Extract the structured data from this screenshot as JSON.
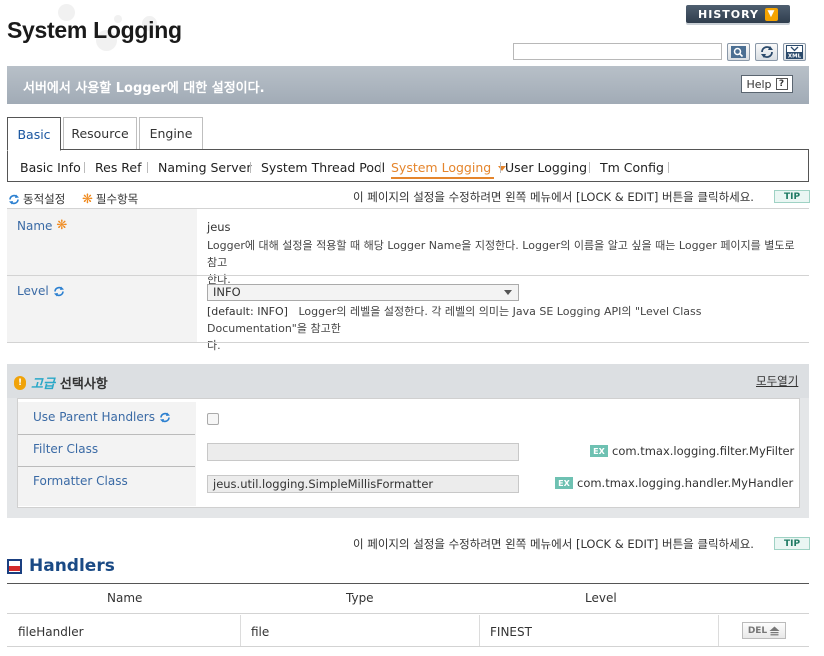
{
  "header": {
    "title": "System Logging",
    "history_label": "HISTORY",
    "search": {
      "value": "",
      "placeholder": ""
    }
  },
  "banner": {
    "text": "서버에서 사용할 Logger에 대한 설정이다.",
    "help_label": "Help",
    "help_icon": "?"
  },
  "tabs": [
    {
      "label": "Basic",
      "active": true
    },
    {
      "label": "Resource",
      "active": false
    },
    {
      "label": "Engine",
      "active": false
    }
  ],
  "subnav": [
    {
      "label": "Basic Info"
    },
    {
      "label": "Res Ref"
    },
    {
      "label": "Naming Server"
    },
    {
      "label": "System Thread Pool"
    },
    {
      "label": "System Logging",
      "active": true
    },
    {
      "label": "User Logging"
    },
    {
      "label": "Tm Config"
    }
  ],
  "legend": {
    "dynamic": "동적설정",
    "required": "필수항목"
  },
  "notice": "이 페이지의 설정을 수정하려면 왼쪽 메뉴에서 [LOCK & EDIT] 버튼을 클릭하세요.",
  "tip_label": "TIP",
  "fields": {
    "name": {
      "label": "Name",
      "value": "jeus",
      "desc_line1": "Logger에 대해 설정을 적용할 때 해당 Logger Name을 지정한다. Logger의 이름을 알고 싶을 때는 Logger 페이지를 별도로 참고",
      "desc_line2": "한다."
    },
    "level": {
      "label": "Level",
      "selected": "INFO",
      "default_text": "[default: INFO]",
      "desc_line1": "Logger의 레벨을 설정한다. 각 레벨의 의미는 Java SE Logging API의 \"Level Class Documentation\"을 참고한",
      "desc_line2": "다."
    }
  },
  "advanced": {
    "title_keyword": "고급",
    "title_rest": "선택사항",
    "open_all": "모두열기",
    "use_parent_handlers": {
      "label": "Use Parent Handlers",
      "checked": false
    },
    "filter_class": {
      "label": "Filter Class",
      "value": "",
      "example": "com.tmax.logging.filter.MyFilter"
    },
    "formatter_class": {
      "label": "Formatter Class",
      "value": "jeus.util.logging.SimpleMillisFormatter",
      "example": "com.tmax.logging.handler.MyHandler"
    },
    "ex_badge": "EX"
  },
  "handlers": {
    "title": "Handlers",
    "columns": [
      "Name",
      "Type",
      "Level"
    ],
    "rows": [
      {
        "name": "fileHandler",
        "type": "file",
        "level": "FINEST",
        "action": "DEL"
      }
    ]
  },
  "colors": {
    "accent_orange": "#e5852c",
    "link_blue": "#3a6aa5",
    "banner_gray": "#a9b2bc",
    "history_dark": "#3b4858"
  },
  "icons": [
    "search-icon",
    "refresh-icon",
    "xml-export-icon",
    "sync-icon",
    "asterisk-icon",
    "warning-icon",
    "help-icon",
    "delete-icon"
  ]
}
